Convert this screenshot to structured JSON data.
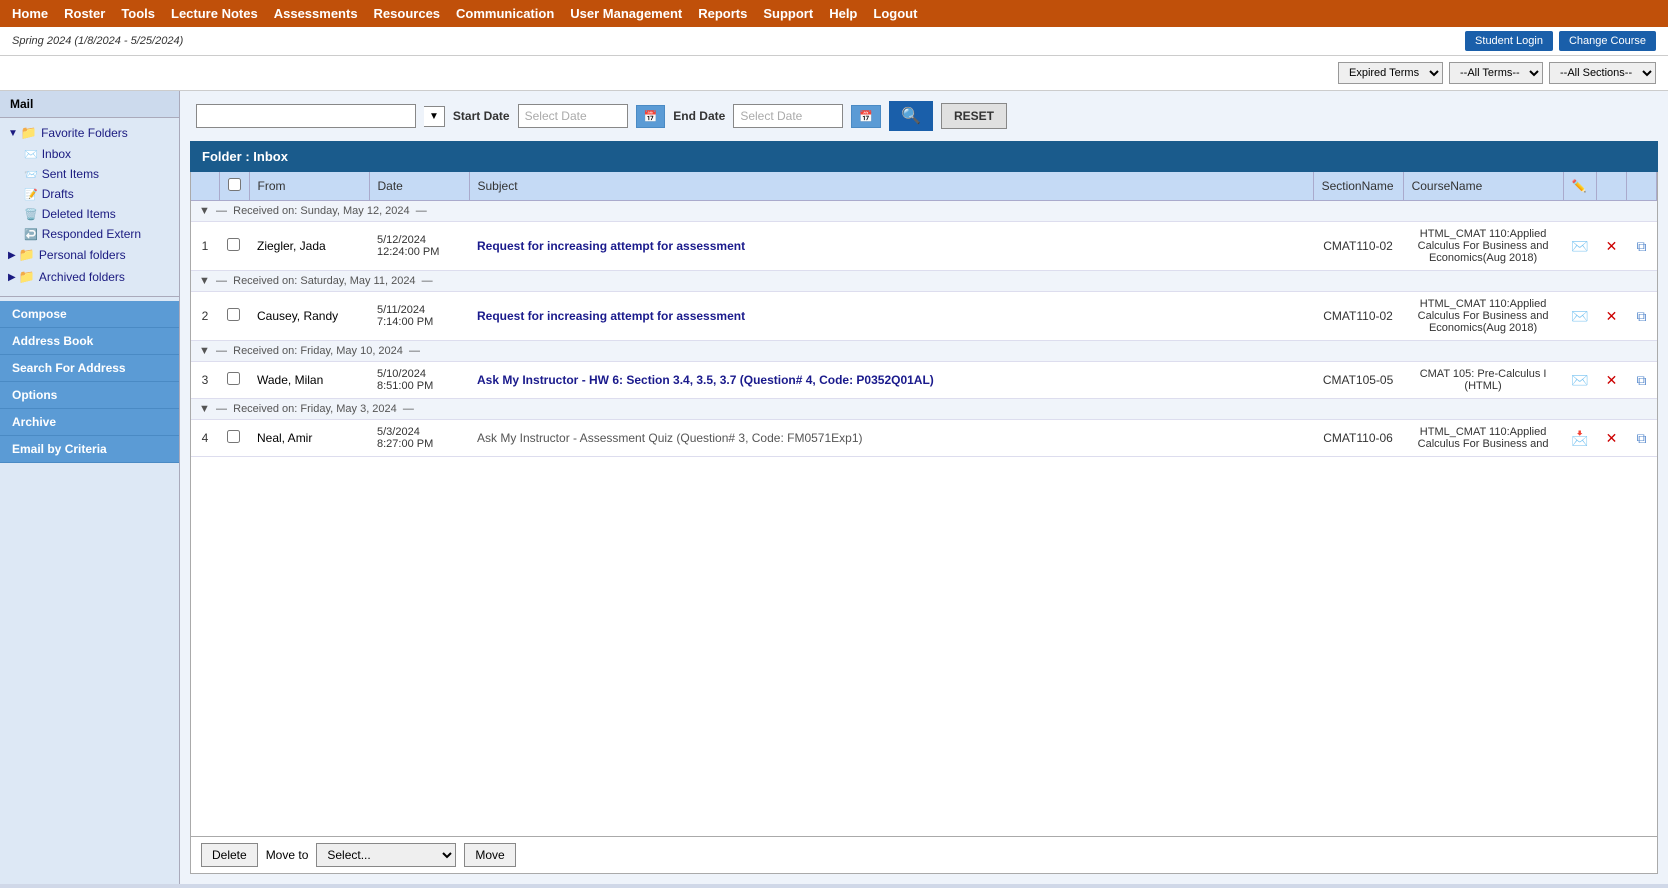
{
  "nav": {
    "items": [
      "Home",
      "Roster",
      "Tools",
      "Lecture Notes",
      "Assessments",
      "Resources",
      "Communication",
      "User Management",
      "Reports",
      "Support",
      "Help",
      "Logout"
    ]
  },
  "subheader": {
    "term": "Spring 2024 (1/8/2024 - 5/25/2024)",
    "student_login": "Student Login",
    "change_course": "Change Course"
  },
  "dropdowns": {
    "terms_label": "Expired Terms",
    "terms_options": [
      "Expired Terms"
    ],
    "all_terms_label": "--All Terms--",
    "all_terms_options": [
      "--All Terms--"
    ],
    "all_sections_label": "--All Sections--",
    "all_sections_options": [
      "--All Sections--"
    ]
  },
  "search": {
    "placeholder": "",
    "start_date_label": "Start Date",
    "start_date_placeholder": "Select Date",
    "end_date_label": "End Date",
    "end_date_placeholder": "Select Date",
    "search_btn": "🔍",
    "reset_btn": "RESET"
  },
  "sidebar": {
    "mail_label": "Mail",
    "favorite_folders_label": "Favorite Folders",
    "inbox_label": "Inbox",
    "sent_items_label": "Sent Items",
    "drafts_label": "Drafts",
    "deleted_items_label": "Deleted Items",
    "responded_extern_label": "Responded Extern",
    "personal_folders_label": "Personal folders",
    "archived_folders_label": "Archived folders",
    "compose_label": "Compose",
    "address_book_label": "Address Book",
    "search_for_address_label": "Search For Address",
    "options_label": "Options",
    "archive_label": "Archive",
    "email_by_criteria_label": "Email by Criteria"
  },
  "folder": {
    "title": "Folder : Inbox",
    "columns": {
      "num": "",
      "checkbox": "",
      "from": "From",
      "date": "Date",
      "subject": "Subject",
      "section": "SectionName",
      "course": "CourseName",
      "pencil": "✏️",
      "action1": "",
      "action2": ""
    }
  },
  "groups": [
    {
      "label": "Received on: Sunday, May 12, 2024",
      "items": [
        {
          "num": "1",
          "from": "Ziegler, Jada",
          "date": "5/12/2024\n12:24:00 PM",
          "subject": "Request for increasing attempt for assessment",
          "subject_read": false,
          "section": "CMAT110-02",
          "course": "HTML_CMAT 110:Applied Calculus For Business and Economics(Aug 2018)",
          "icon": "mail",
          "icon_open": false
        }
      ]
    },
    {
      "label": "Received on: Saturday, May 11, 2024",
      "items": [
        {
          "num": "2",
          "from": "Causey, Randy",
          "date": "5/11/2024\n7:14:00 PM",
          "subject": "Request for increasing attempt for assessment",
          "subject_read": false,
          "section": "CMAT110-02",
          "course": "HTML_CMAT 110:Applied Calculus For Business and Economics(Aug 2018)",
          "icon": "mail",
          "icon_open": false
        }
      ]
    },
    {
      "label": "Received on: Friday, May 10, 2024",
      "items": [
        {
          "num": "3",
          "from": "Wade, Milan",
          "date": "5/10/2024\n8:51:00 PM",
          "subject": "Ask My Instructor - HW 6: Section 3.4, 3.5, 3.7 (Question# 4, Code: P0352Q01AL)",
          "subject_read": false,
          "section": "CMAT105-05",
          "course": "CMAT 105: Pre-Calculus I (HTML)",
          "icon": "mail",
          "icon_open": false
        }
      ]
    },
    {
      "label": "Received on: Friday, May 3, 2024",
      "items": [
        {
          "num": "4",
          "from": "Neal, Amir",
          "date": "5/3/2024\n8:27:00 PM",
          "subject": "Ask My Instructor - Assessment Quiz (Question# 3, Code: FM0571Exp1)",
          "subject_read": true,
          "section": "CMAT110-06",
          "course": "HTML_CMAT 110:Applied Calculus For Business and",
          "icon": "mail-open",
          "icon_open": true
        }
      ]
    }
  ],
  "bottom": {
    "delete_label": "Delete",
    "move_to_label": "Move to",
    "move_options": [
      "Select..."
    ],
    "move_btn_label": "Move"
  }
}
